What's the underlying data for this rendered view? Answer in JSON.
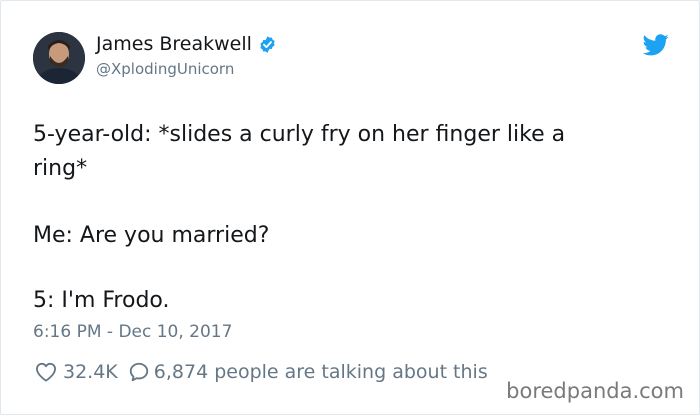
{
  "user": {
    "display_name": "James Breakwell",
    "handle": "@XplodingUnicorn",
    "verified_icon": "verified-badge-icon",
    "avatar": "avatar"
  },
  "brand": {
    "icon": "twitter-bird-icon",
    "color": "#1da1f2"
  },
  "tweet": {
    "lines": [
      "5-year-old: *slides a curly fry on her finger like a",
      "ring*",
      "Me: Are you married?",
      "5: I'm Frodo."
    ],
    "timestamp": "6:16 PM - Dec 10, 2017"
  },
  "stats": {
    "likes": "32.4K",
    "like_icon": "heart-icon",
    "reply_icon": "reply-bubble-icon",
    "talking": "6,874 people are talking about this"
  },
  "watermark": "boredpanda.com",
  "colors": {
    "text": "#14171a",
    "secondary": "#657786",
    "border": "#e1e8ed"
  }
}
